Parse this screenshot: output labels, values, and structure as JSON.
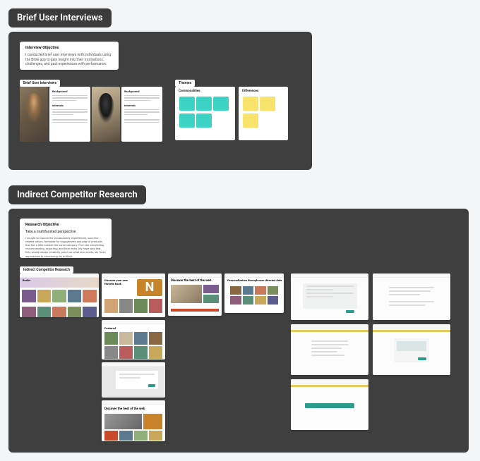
{
  "sections": {
    "interviews": {
      "title": "Brief User Interviews",
      "objective_note": {
        "title": "Interview Objective",
        "body": "I conducted brief user interviews with individuals using the Bible app to gain insight into their motivations, challenges, and past experiences with performance."
      },
      "tab_label": "Brief User Interviews",
      "themes_tab": "Themes",
      "group_labels": {
        "commonalities": "Commonalities",
        "differences": "Differences"
      },
      "interview_cards": [
        {
          "heading": "Background",
          "sub": "Interests"
        },
        {
          "heading": "Background",
          "sub": "Interests"
        }
      ]
    },
    "research": {
      "title": "Indirect Competitor Research",
      "objective_note": {
        "title": "Research Objective",
        "subtitle": "Take a multifaceted perspective",
        "body": "I sought to explore the vocabularies, experiences, success-related values, formulas for engagement and play of products that fall a little outside the same category. Five star storytelling, recommending, exporting, and form entry. My hope was that they would inspire creativity, point out what else exists, stir fresh approaches to structuring my artifact."
      },
      "tab_label": "Indirect Competitor Research",
      "shot_titles": {
        "s1": "Books",
        "s2": "Discover your new favorite book",
        "s3": "Discover the best of the web",
        "s4": "Personalization through user-directed data",
        "s5": "Featured",
        "s6": "Discover the best of the web"
      }
    }
  }
}
